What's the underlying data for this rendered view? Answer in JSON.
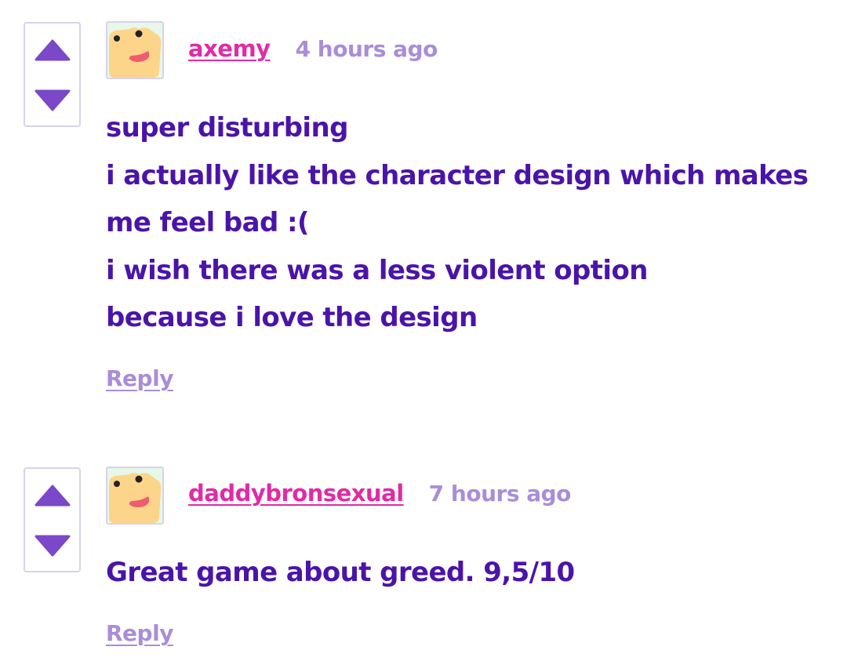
{
  "colors": {
    "username": "#e02ba6",
    "timestamp": "#a98dd8",
    "body_text": "#4b14a8",
    "vote_arrow": "#7a48c8",
    "border": "#d9d2ea",
    "avatar_bg": "#e6f8e9",
    "avatar_face": "#fcd58a",
    "avatar_mouth": "#ef5c6f"
  },
  "comments": [
    {
      "username": "axemy",
      "timestamp": "4 hours ago",
      "avatar_icon": "frog-avatar-icon",
      "body_lines": [
        "super disturbing",
        "i actually like the character design which makes",
        "me feel bad :(",
        "i wish there was a less violent option",
        "because i love the design"
      ],
      "reply_label": "Reply"
    },
    {
      "username": "daddybronsexual",
      "timestamp": "7 hours ago",
      "avatar_icon": "frog-avatar-icon",
      "body_lines": [
        "Great game about greed. 9,5/10"
      ],
      "reply_label": "Reply"
    }
  ]
}
